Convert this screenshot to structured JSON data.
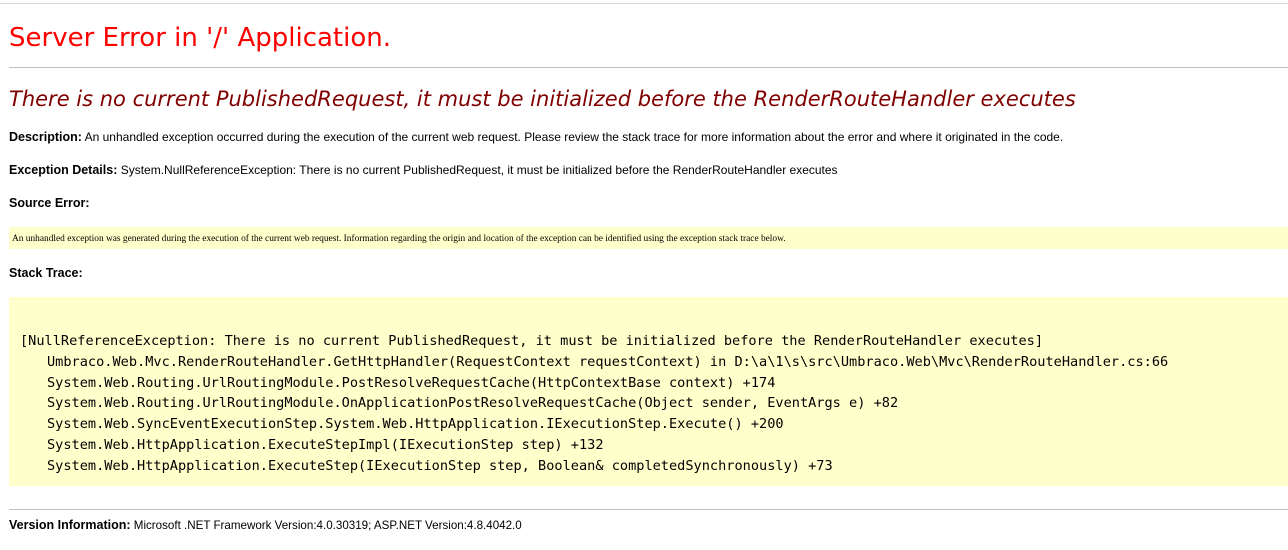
{
  "title": "Server Error in '/' Application.",
  "subtitle": "There is no current PublishedRequest, it must be initialized before the RenderRouteHandler executes",
  "description": {
    "label": "Description:",
    "text": "An unhandled exception occurred during the execution of the current web request. Please review the stack trace for more information about the error and where it originated in the code."
  },
  "exception_details": {
    "label": "Exception Details:",
    "text": "System.NullReferenceException: There is no current PublishedRequest, it must be initialized before the RenderRouteHandler executes"
  },
  "source_error": {
    "label": "Source Error:",
    "text": "An unhandled exception was generated during the execution of the current web request. Information regarding the origin and location of the exception can be identified using the exception stack trace below."
  },
  "stack_trace": {
    "label": "Stack Trace:",
    "lines": [
      "[NullReferenceException: There is no current PublishedRequest, it must be initialized before the RenderRouteHandler executes]",
      "Umbraco.Web.Mvc.RenderRouteHandler.GetHttpHandler(RequestContext requestContext) in D:\\a\\1\\s\\src\\Umbraco.Web\\Mvc\\RenderRouteHandler.cs:66",
      "System.Web.Routing.UrlRoutingModule.PostResolveRequestCache(HttpContextBase context) +174",
      "System.Web.Routing.UrlRoutingModule.OnApplicationPostResolveRequestCache(Object sender, EventArgs e) +82",
      "System.Web.SyncEventExecutionStep.System.Web.HttpApplication.IExecutionStep.Execute() +200",
      "System.Web.HttpApplication.ExecuteStepImpl(IExecutionStep step) +132",
      "System.Web.HttpApplication.ExecuteStep(IExecutionStep step, Boolean& completedSynchronously) +73"
    ]
  },
  "version_information": {
    "label": "Version Information:",
    "text": "Microsoft .NET Framework Version:4.0.30319; ASP.NET Version:4.8.4042.0"
  },
  "colors": {
    "title": "#ff0000",
    "subtitle": "#800000",
    "code_background": "#ffffcc",
    "rule": "#c0c0c0"
  }
}
